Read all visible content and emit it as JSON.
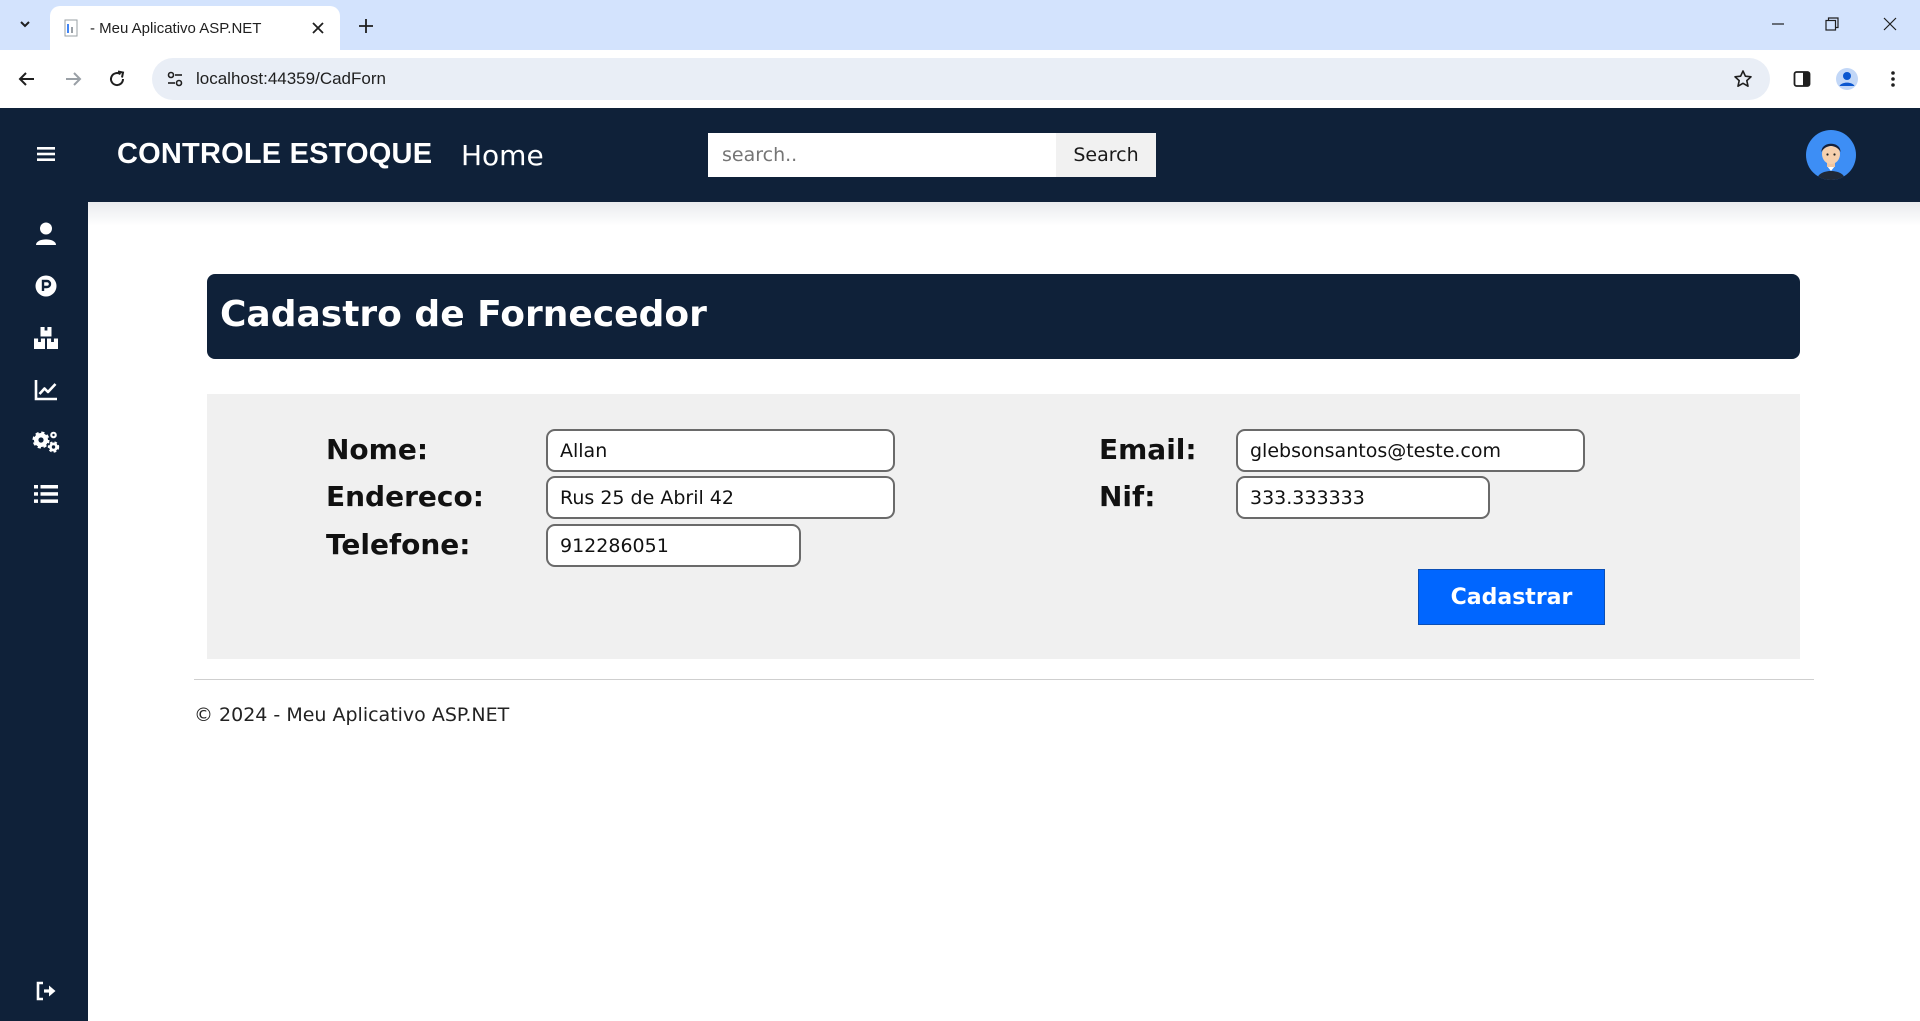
{
  "browser": {
    "tab_title": "- Meu Aplicativo ASP.NET",
    "url": "localhost:44359/CadForn"
  },
  "header": {
    "brand": "CONTROLE ESTOQUE",
    "home": "Home",
    "search_placeholder": "search..",
    "search_button": "Search"
  },
  "sidebar": {
    "items": [
      {
        "icon": "menu-icon"
      },
      {
        "icon": "user-icon"
      },
      {
        "icon": "parking-icon"
      },
      {
        "icon": "boxes-icon"
      },
      {
        "icon": "chart-line-icon"
      },
      {
        "icon": "cogs-icon"
      },
      {
        "icon": "list-icon"
      },
      {
        "icon": "sign-out-icon"
      }
    ]
  },
  "page": {
    "title": "Cadastro de Fornecedor"
  },
  "form": {
    "nome_label": "Nome:",
    "nome_value": "Allan",
    "endereco_label": "Endereco:",
    "endereco_value": "Rus 25 de Abril 42",
    "telefone_label": "Telefone:",
    "telefone_value": "912286051",
    "email_label": "Email:",
    "email_value": "glebsonsantos@teste.com",
    "nif_label": "Nif:",
    "nif_value": "333.333333",
    "submit_label": "Cadastrar"
  },
  "footer": {
    "text": "© 2024 - Meu Aplicativo ASP.NET"
  },
  "colors": {
    "navy": "#0f2139",
    "primary_button": "#0066ff",
    "panel_bg": "#f0f0f0",
    "browser_tabstrip": "#d3e3fd"
  }
}
